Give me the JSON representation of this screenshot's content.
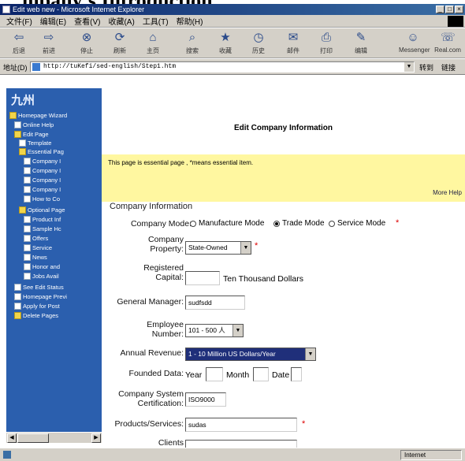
{
  "heading": "mpany's Introduction",
  "window": {
    "title": "Edit web new - Microsoft Internet Explorer",
    "buttons": [
      "_",
      "□",
      "×"
    ]
  },
  "menu": [
    "文件(F)",
    "编辑(E)",
    "查看(V)",
    "收藏(A)",
    "工具(T)",
    "帮助(H)"
  ],
  "toolbar": [
    {
      "icon": "back-icon",
      "glyph": "⇦",
      "label": "后退"
    },
    {
      "icon": "forward-icon",
      "glyph": "⇨",
      "label": "前进"
    },
    {
      "icon": "stop-icon",
      "glyph": "⊗",
      "label": "停止"
    },
    {
      "icon": "refresh-icon",
      "glyph": "⟳",
      "label": "刷新"
    },
    {
      "icon": "home-icon",
      "glyph": "⌂",
      "label": "主页"
    },
    {
      "icon": "search-icon",
      "glyph": "⌕",
      "label": "搜索"
    },
    {
      "icon": "favorites-icon",
      "glyph": "★",
      "label": "收藏"
    },
    {
      "icon": "history-icon",
      "glyph": "◷",
      "label": "历史"
    },
    {
      "icon": "mail-icon",
      "glyph": "✉",
      "label": "邮件"
    },
    {
      "icon": "print-icon",
      "glyph": "⎙",
      "label": "打印"
    },
    {
      "icon": "edit-icon",
      "glyph": "✎",
      "label": "编辑"
    },
    {
      "icon": "messenger-icon",
      "glyph": "☺",
      "label": "Messenger"
    },
    {
      "icon": "discuss-icon",
      "glyph": "☏",
      "label": "Real.com"
    }
  ],
  "address": {
    "label": "地址(D)",
    "url": "http://tuKefi/sed-english/Step1.htm",
    "go_label": "转到",
    "links_label": "链接"
  },
  "sidebar": {
    "logo": "九州",
    "items": [
      {
        "label": "Homepage Wizard",
        "type": "folder"
      },
      {
        "label": "Online Help",
        "type": "page"
      },
      {
        "label": "Edit Page",
        "type": "folder"
      },
      {
        "label": "Template",
        "type": "page"
      },
      {
        "label": "Essential Pag",
        "type": "folder"
      },
      {
        "label": "Company I",
        "type": "page"
      },
      {
        "label": "Company I",
        "type": "page"
      },
      {
        "label": "Company I",
        "type": "page"
      },
      {
        "label": "Company I",
        "type": "page"
      },
      {
        "label": "How to Co",
        "type": "page"
      },
      {
        "label": "Optional Page",
        "type": "folder"
      },
      {
        "label": "Product Inf",
        "type": "page"
      },
      {
        "label": "Sample Hc",
        "type": "page"
      },
      {
        "label": "Offers",
        "type": "page"
      },
      {
        "label": "Service",
        "type": "page"
      },
      {
        "label": "News",
        "type": "page"
      },
      {
        "label": "Honor and",
        "type": "page"
      },
      {
        "label": "Jobs Avail",
        "type": "page"
      },
      {
        "label": "See Edit Status",
        "type": "page"
      },
      {
        "label": "Homepage Previ",
        "type": "page"
      },
      {
        "label": "Apply for Post",
        "type": "page"
      },
      {
        "label": "Delete Pages",
        "type": "folder"
      }
    ]
  },
  "content": {
    "page_title": "Edit Company Information",
    "notice": "This page is essential page , *means essential item.",
    "more_help": "More Help",
    "section_title": "Company Information",
    "company_mode": {
      "label": "Company Mode:",
      "options": [
        "Manufacture Mode",
        "Trade Mode",
        "Service Mode"
      ],
      "selected": 1,
      "required_mark": "*"
    },
    "company_property": {
      "label": "Company Property:",
      "value": "State-Owned",
      "required_mark": "*"
    },
    "registered_capital": {
      "label": "Registered Capital:",
      "value": "",
      "unit": "Ten Thousand Dollars"
    },
    "general_manager": {
      "label": "General Manager:",
      "value": "sudfsdd"
    },
    "employee_number": {
      "label": "Employee Number:",
      "value": "101 - 500 人"
    },
    "annual_revenue": {
      "label": "Annual Revenue:",
      "value": "1 - 10 Million US Dollars/Year"
    },
    "founded_date": {
      "label": "Founded Data:",
      "year_label": "Year",
      "month_label": "Month",
      "date_label": "Date"
    },
    "certification": {
      "label": "Company System Certification:",
      "value": "ISO9000"
    },
    "products": {
      "label": "Products/Services:",
      "value": "sudas",
      "required_mark": "*"
    },
    "clients": {
      "label": "Clients"
    }
  },
  "status": {
    "zone": "Internet"
  }
}
